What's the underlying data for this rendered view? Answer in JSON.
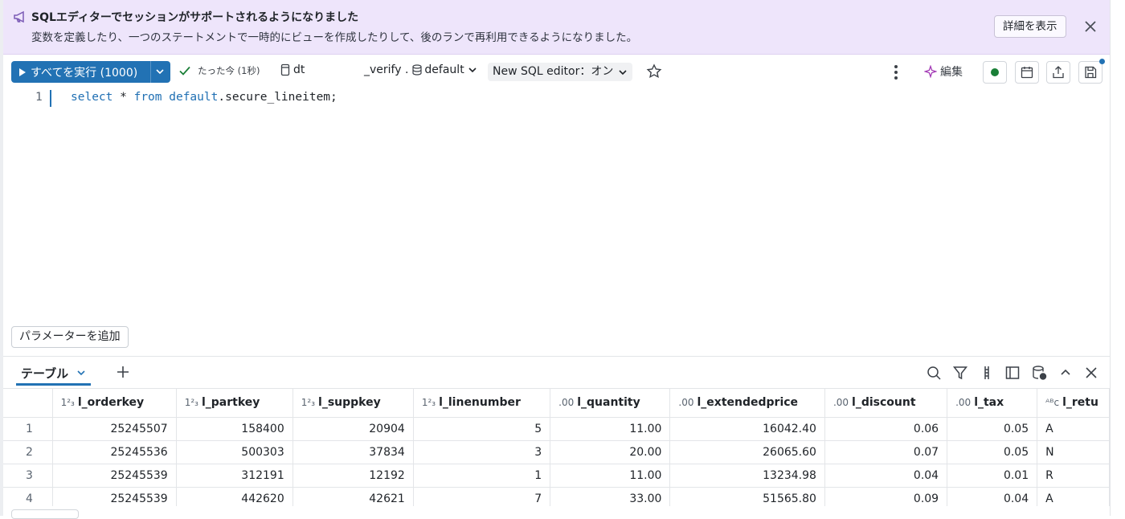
{
  "banner": {
    "title": "SQLエディターでセッションがサポートされるようになりました",
    "description": "変数を定義したり、一つのステートメントで一時的にビューを作成したりして、後のランで再利用できるようになりました。",
    "detail_button": "詳細を表示",
    "icons": [
      "megaphone-icon",
      "close-icon"
    ]
  },
  "toolbar": {
    "run_label": "すべてを実行 (1000)",
    "status_text": "たった今 (1秒)",
    "catalog": "dt",
    "schema_prefix": "_verify .",
    "schema": "default",
    "editor_toggle": "New SQL editor：オン",
    "edit_label": "編集"
  },
  "editor": {
    "line_number": "1",
    "code": {
      "kw1": "select",
      "star": " * ",
      "kw2": "from",
      "ident_kw": " default",
      "rest": ".secure_lineitem;"
    }
  },
  "parameter_button": "パラメーターを追加",
  "results": {
    "tab_label": "テーブル",
    "columns": [
      {
        "type": "1²₃",
        "name": "l_orderkey"
      },
      {
        "type": "1²₃",
        "name": "l_partkey"
      },
      {
        "type": "1²₃",
        "name": "l_suppkey"
      },
      {
        "type": "1²₃",
        "name": "l_linenumber"
      },
      {
        "type": ".00",
        "name": "l_quantity"
      },
      {
        "type": ".00",
        "name": "l_extendedprice"
      },
      {
        "type": ".00",
        "name": "l_discount"
      },
      {
        "type": ".00",
        "name": "l_tax"
      },
      {
        "type": "ᴬᴮc",
        "name": "l_retu"
      }
    ],
    "rows": [
      [
        "1",
        "25245507",
        "158400",
        "20904",
        "5",
        "11.00",
        "16042.40",
        "0.06",
        "0.05",
        "A"
      ],
      [
        "2",
        "25245536",
        "500303",
        "37834",
        "3",
        "20.00",
        "26065.60",
        "0.07",
        "0.05",
        "N"
      ],
      [
        "3",
        "25245539",
        "312191",
        "12192",
        "1",
        "11.00",
        "13234.98",
        "0.04",
        "0.01",
        "R"
      ],
      [
        "4",
        "25245539",
        "442620",
        "42621",
        "7",
        "33.00",
        "51565.80",
        "0.09",
        "0.04",
        "A"
      ]
    ]
  },
  "colors": {
    "accent": "#2272b4",
    "banner_bg": "#eee5fb",
    "status_green": "#1a7f37"
  }
}
